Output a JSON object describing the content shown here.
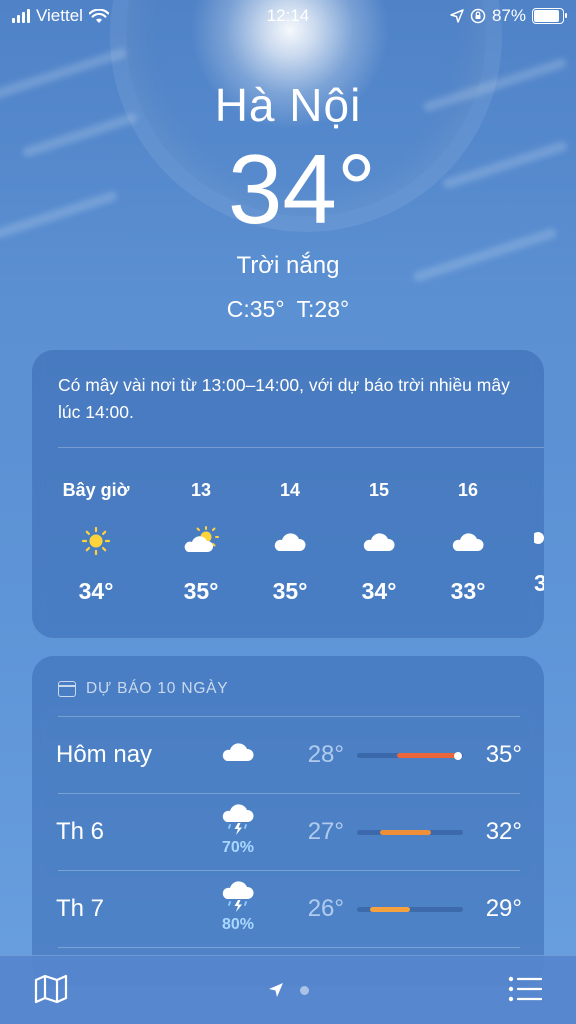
{
  "status": {
    "carrier": "Viettel",
    "time": "12:14",
    "battery": "87%",
    "battery_level": 0.87
  },
  "location": {
    "city": "Hà Nội",
    "temp": "34°",
    "condition": "Trời nắng",
    "high": "C:35°",
    "low": "T:28°"
  },
  "hourly": {
    "summary": "Có mây vài nơi từ 13:00–14:00, với dự báo trời nhiều mây lúc 14:00.",
    "items": [
      {
        "label": "Bây giờ",
        "icon": "sun-icon",
        "temp": "34°"
      },
      {
        "label": "13",
        "icon": "partly-cloudy-icon",
        "temp": "35°"
      },
      {
        "label": "14",
        "icon": "cloud-icon",
        "temp": "35°"
      },
      {
        "label": "15",
        "icon": "cloud-icon",
        "temp": "34°"
      },
      {
        "label": "16",
        "icon": "cloud-icon",
        "temp": "33°"
      },
      {
        "label": "",
        "icon": "cloud-icon",
        "temp": "3"
      }
    ]
  },
  "daily": {
    "header": "DỰ BÁO 10 NGÀY",
    "rows": [
      {
        "day": "Hôm nay",
        "icon": "cloud-icon",
        "precip": "",
        "low": "28°",
        "high": "35°",
        "range_start": 0.38,
        "range_end": 0.95,
        "current": 0.95,
        "color": "#e8663a"
      },
      {
        "day": "Th 6",
        "icon": "thunderstorm-icon",
        "precip": "70%",
        "low": "27°",
        "high": "32°",
        "range_start": 0.22,
        "range_end": 0.7,
        "color": "#ef8f3a"
      },
      {
        "day": "Th 7",
        "icon": "thunderstorm-icon",
        "precip": "80%",
        "low": "26°",
        "high": "29°",
        "range_start": 0.12,
        "range_end": 0.5,
        "color": "#f4a23f"
      }
    ]
  },
  "toolbar": {
    "map_icon": "map-icon",
    "location_icon": "location-arrow-icon",
    "list_icon": "list-icon"
  }
}
